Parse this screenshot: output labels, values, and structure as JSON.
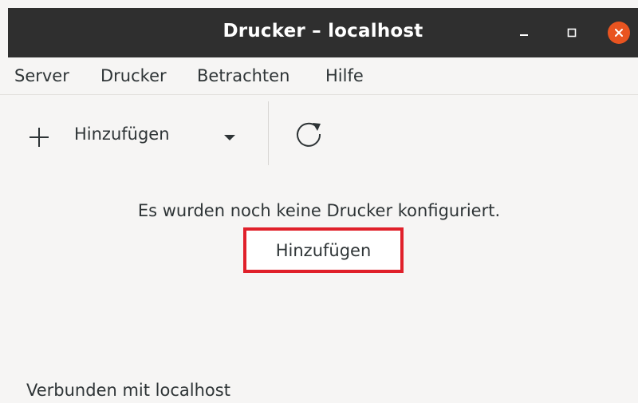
{
  "window": {
    "title": "Drucker – localhost",
    "close_color": "#e95420"
  },
  "menubar": {
    "items": [
      "Server",
      "Drucker",
      "Betrachten",
      "Hilfe"
    ]
  },
  "toolbar": {
    "add_label": "Hinzufügen",
    "add_icon": "plus-icon",
    "dropdown_icon": "chevron-down-icon",
    "refresh_icon": "refresh-icon"
  },
  "main": {
    "empty_message": "Es wurden noch keine Drucker konfiguriert.",
    "add_button_label": "Hinzufügen",
    "highlight_color": "#e0202a"
  },
  "status": {
    "text": "Verbunden mit localhost"
  }
}
